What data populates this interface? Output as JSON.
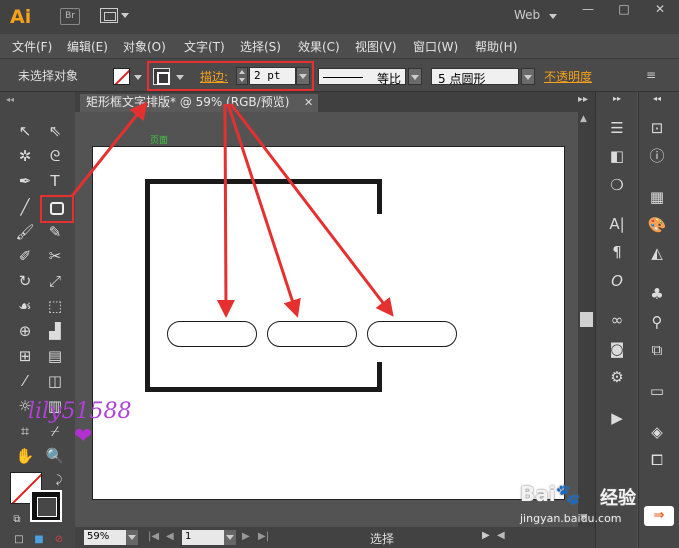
{
  "titlebar": {
    "app_logo": "Ai",
    "bridge_label": "Br",
    "workspace": "Web",
    "window_controls": [
      "—",
      "□",
      "✕"
    ]
  },
  "menubar": {
    "items": [
      "文件(F)",
      "编辑(E)",
      "对象(O)",
      "文字(T)",
      "选择(S)",
      "效果(C)",
      "视图(V)",
      "窗口(W)",
      "帮助(H)"
    ]
  },
  "controlbar": {
    "selection_status": "未选择对象",
    "stroke_label": "描边:",
    "stroke_weight": "2 pt",
    "profile_label": "等比",
    "brush_label": "5 点圆形",
    "opacity_label": "不透明度",
    "panel_menu": "≡"
  },
  "document": {
    "tab_title": "矩形框文字排版* @ 59% (RGB/预览)",
    "close": "✕",
    "artboard_label": "页面"
  },
  "statusbar": {
    "zoom": "59%",
    "page": "1",
    "status": "选择"
  },
  "watermark": {
    "text": "lily51588",
    "heart": "❤"
  },
  "colors": {
    "accent": "#f6a11b",
    "highlight_box": "#e53030",
    "canvas_bg": "#535353",
    "artboard": "#ffffff"
  },
  "tools_left": [
    "selection-tool",
    "direct-selection-tool",
    "magic-wand-tool",
    "lasso-tool",
    "pen-tool",
    "type-tool",
    "line-tool",
    "rounded-rectangle-tool",
    "paintbrush-tool",
    "pencil-tool",
    "blob-brush-tool",
    "scissors-tool",
    "rotate-tool",
    "scale-tool",
    "warp-tool",
    "free-transform-tool",
    "shape-builder-tool",
    "graph-tool",
    "mesh-tool",
    "gradient-tool",
    "eyedropper-tool",
    "blend-tool",
    "symbol-sprayer-tool",
    "column-graph-tool",
    "artboard-tool",
    "slice-tool",
    "hand-tool",
    "zoom-tool"
  ]
}
